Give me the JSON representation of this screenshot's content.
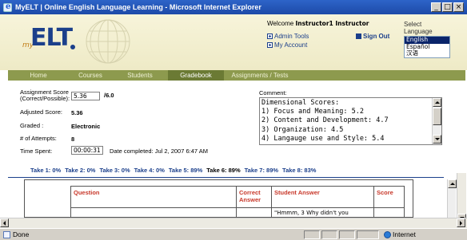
{
  "window": {
    "title": "MyELT | Online English Language Learning - Microsoft Internet Explorer"
  },
  "header": {
    "logo_my": "my",
    "logo_elt": "ELT",
    "welcome_prefix": "Welcome",
    "welcome_user": "Instructor1 Instructor",
    "admin_tools": "Admin Tools",
    "my_account": "My Account",
    "sign_out": "Sign Out",
    "language": {
      "label": "Select Language",
      "options": [
        "English",
        "Español",
        "汉语"
      ],
      "selected": "English"
    }
  },
  "nav": {
    "tabs": [
      {
        "label": "Home"
      },
      {
        "label": "Courses"
      },
      {
        "label": "Students"
      },
      {
        "label": "Gradebook"
      },
      {
        "label": "Assignments / Tests"
      }
    ],
    "active": "Gradebook"
  },
  "form": {
    "assignment_score_label": "Assignment Score",
    "assignment_score_sublabel": "(Correct/Possible):",
    "assignment_score_value": "5.36",
    "assignment_score_possible": "/6.0",
    "adjusted_score_label": "Adjusted Score:",
    "adjusted_score_value": "5.36",
    "graded_label": "Graded :",
    "graded_value": "Electronic",
    "attempts_label": "# of Attempts:",
    "attempts_value": "8",
    "time_spent_label": "Time Spent:",
    "time_spent_value": "00:00:31",
    "date_completed": "Date completed: Jul 2, 2007 6:47 AM",
    "comment_label": "Comment:",
    "comment_lines": [
      "Dimensional Scores:",
      "1) Focus and Meaning: 5.2",
      "2) Content and Development: 4.7",
      "3) Organization: 4.5",
      "4) Langauge use and Style: 5.4"
    ]
  },
  "takes": [
    {
      "label": "Take 1: 0%"
    },
    {
      "label": "Take 2: 0%"
    },
    {
      "label": "Take 3: 0%"
    },
    {
      "label": "Take 4: 0%"
    },
    {
      "label": "Take 5: 89%"
    },
    {
      "label": "Take 6: 89%"
    },
    {
      "label": "Take 7: 89%"
    },
    {
      "label": "Take 8: 83%"
    }
  ],
  "current_take": "Take 6: 89%",
  "table": {
    "headers": [
      "Question",
      "Correct Answer",
      "Student Answer",
      "Score"
    ],
    "first_row_student_answer": "\"Hmmm, 3 Why didn't you"
  },
  "statusbar": {
    "status": "Done",
    "zone": "Internet"
  }
}
